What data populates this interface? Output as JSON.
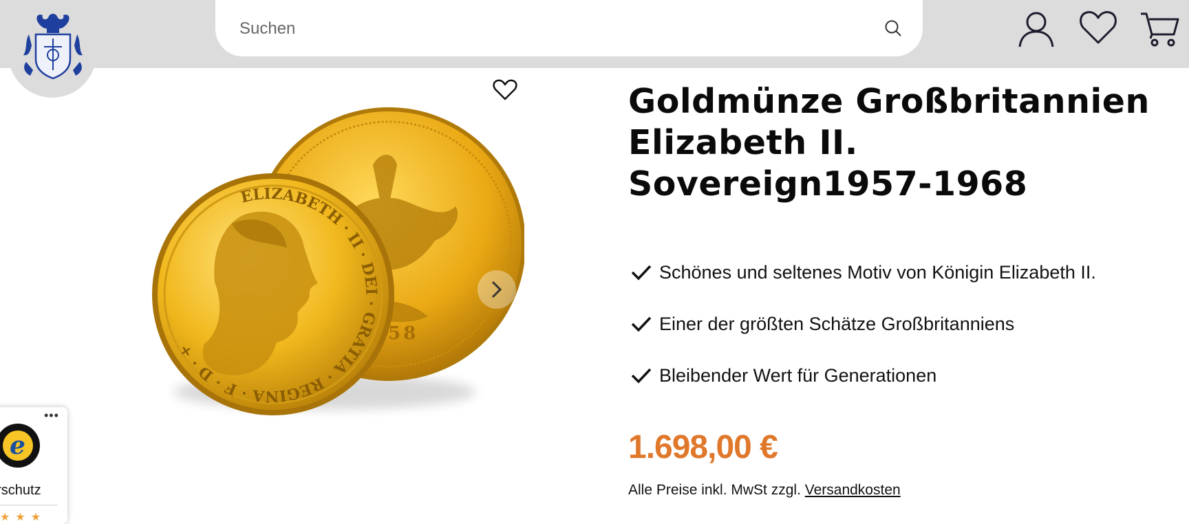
{
  "header": {
    "logo_name": "coat-of-arms-logo",
    "search": {
      "placeholder": "Suchen"
    },
    "icons": [
      "account-icon",
      "wishlist-heart-icon",
      "cart-icon"
    ]
  },
  "product": {
    "title": "Goldmünze Großbritannien Elizabeth II. Sovereign1957-1968",
    "image_coin_year": "1958",
    "image_obverse_legend": "ELIZABETH · II · DEI · GRATIA · REGINA · F · D · +",
    "features": [
      "Schönes und seltenes Motiv von Königin Elizabeth II.",
      "Einer der größten Schätze Großbritanniens",
      "Bleibender Wert für Generationen"
    ],
    "price": "1.698,00 €",
    "price_note_prefix": "Alle Preise inkl. MwSt zzgl. ",
    "price_note_link": "Versandkosten"
  },
  "trusted_shops": {
    "dots": "•••",
    "badge_letter": "e",
    "text": "erschutz",
    "stars": "★★★"
  },
  "colors": {
    "accent_price": "#e0782b",
    "header_bg": "#dcdcdc",
    "gold": "#e8b52a"
  }
}
